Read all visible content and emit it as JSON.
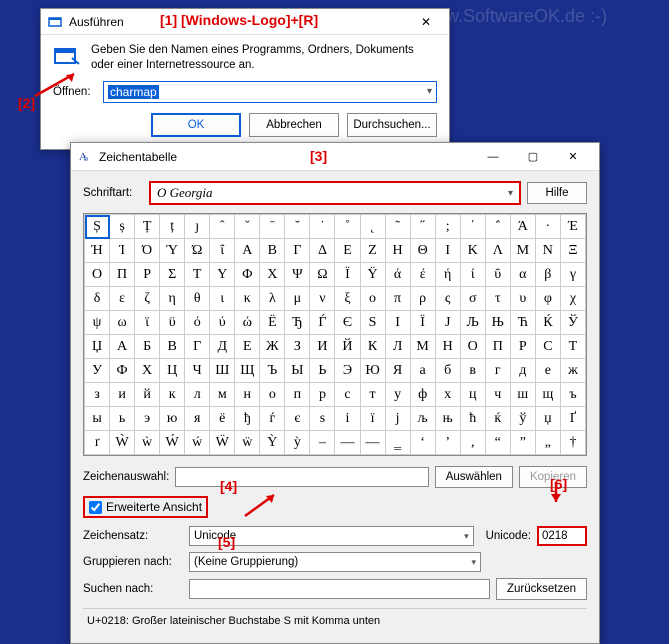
{
  "watermarks": [
    "www.SoftwareOK.de :-)"
  ],
  "annotations": {
    "a1": "[1]  [Windows-Logo]+[R]",
    "a2": "[2]",
    "a3": "[3]",
    "a4": "[4]",
    "a5": "[5]",
    "a6": "[6]"
  },
  "run": {
    "title": "Ausführen",
    "description": "Geben Sie den Namen eines Programms, Ordners, Dokuments oder einer Internetressource an.",
    "open_label": "Öffnen:",
    "input_value": "charmap",
    "ok": "OK",
    "cancel": "Abbrechen",
    "browse": "Durchsuchen..."
  },
  "charmap": {
    "title": "Zeichentabelle",
    "font_label": "Schriftart:",
    "font_value": "Georgia",
    "help": "Hilfe",
    "grid": [
      [
        "Ș",
        "ș",
        "Ț",
        "ț",
        "ȷ",
        "ˆ",
        "ˇ",
        "ˉ",
        "˘",
        "˙",
        "˚",
        "˛",
        "˜",
        "˝",
        ";",
        "΄",
        "΅",
        "Ά",
        "·",
        "Έ"
      ],
      [
        "Ή",
        "Ί",
        "Ό",
        "Ύ",
        "Ώ",
        "ΐ",
        "Α",
        "Β",
        "Γ",
        "Δ",
        "Ε",
        "Ζ",
        "Η",
        "Θ",
        "Ι",
        "Κ",
        "Λ",
        "Μ",
        "Ν",
        "Ξ"
      ],
      [
        "Ο",
        "Π",
        "Ρ",
        "Σ",
        "Τ",
        "Υ",
        "Φ",
        "Χ",
        "Ψ",
        "Ω",
        "Ϊ",
        "Ϋ",
        "ά",
        "έ",
        "ή",
        "ί",
        "ΰ",
        "α",
        "β",
        "γ"
      ],
      [
        "δ",
        "ε",
        "ζ",
        "η",
        "θ",
        "ι",
        "κ",
        "λ",
        "μ",
        "ν",
        "ξ",
        "ο",
        "π",
        "ρ",
        "ς",
        "σ",
        "τ",
        "υ",
        "φ",
        "χ"
      ],
      [
        "ψ",
        "ω",
        "ϊ",
        "ϋ",
        "ό",
        "ύ",
        "ώ",
        "Ё",
        "Ђ",
        "Ѓ",
        "Є",
        "Ѕ",
        "І",
        "Ї",
        "Ј",
        "Љ",
        "Њ",
        "Ћ",
        "Ќ",
        "Ў"
      ],
      [
        "Џ",
        "А",
        "Б",
        "В",
        "Г",
        "Д",
        "Е",
        "Ж",
        "З",
        "И",
        "Й",
        "К",
        "Л",
        "М",
        "Н",
        "О",
        "П",
        "Р",
        "С",
        "Т"
      ],
      [
        "У",
        "Ф",
        "Х",
        "Ц",
        "Ч",
        "Ш",
        "Щ",
        "Ъ",
        "Ы",
        "Ь",
        "Э",
        "Ю",
        "Я",
        "а",
        "б",
        "в",
        "г",
        "д",
        "е",
        "ж"
      ],
      [
        "з",
        "и",
        "й",
        "к",
        "л",
        "м",
        "н",
        "о",
        "п",
        "р",
        "с",
        "т",
        "у",
        "ф",
        "х",
        "ц",
        "ч",
        "ш",
        "щ",
        "ъ"
      ],
      [
        "ы",
        "ь",
        "э",
        "ю",
        "я",
        "ё",
        "ђ",
        "ѓ",
        "є",
        "ѕ",
        "і",
        "ї",
        "ј",
        "љ",
        "њ",
        "ћ",
        "ќ",
        "ў",
        "џ",
        "Ґ"
      ],
      [
        "ґ",
        "Ẁ",
        "ẁ",
        "Ẃ",
        "ẃ",
        "Ẅ",
        "ẅ",
        "Ỳ",
        "ỳ",
        "–",
        "—",
        "―",
        "‗",
        "‘",
        "’",
        "‚",
        "“",
        "”",
        "„",
        "†"
      ]
    ],
    "selection_label": "Zeichenauswahl:",
    "select_btn": "Auswählen",
    "copy_btn": "Kopieren",
    "advanced": "Erweiterte Ansicht",
    "charset_label": "Zeichensatz:",
    "charset_value": "Unicode",
    "unicode_label": "Unicode:",
    "unicode_value": "0218",
    "group_label": "Gruppieren nach:",
    "group_value": "(Keine Gruppierung)",
    "search_label": "Suchen nach:",
    "reset_btn": "Zurücksetzen",
    "status": "U+0218: Großer lateinischer Buchstabe S mit Komma unten"
  }
}
